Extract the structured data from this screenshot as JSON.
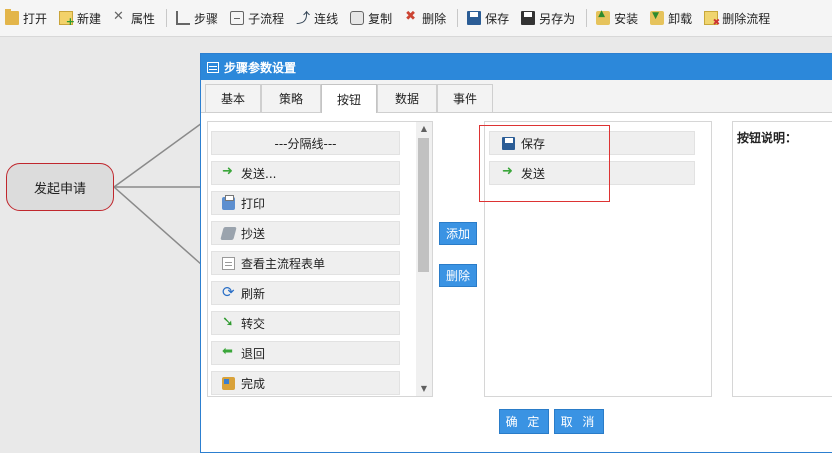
{
  "toolbar": {
    "items": [
      {
        "label": "打开",
        "icon": "folder-open-icon"
      },
      {
        "label": "新建",
        "icon": "new-icon"
      },
      {
        "label": "属性",
        "icon": "tools-icon"
      },
      {
        "label": "步骤",
        "icon": "step-icon"
      },
      {
        "label": "子流程",
        "icon": "subflow-icon"
      },
      {
        "label": "连线",
        "icon": "link-icon"
      },
      {
        "label": "复制",
        "icon": "copy-icon"
      },
      {
        "label": "删除",
        "icon": "delete-icon"
      },
      {
        "label": "保存",
        "icon": "save-icon"
      },
      {
        "label": "另存为",
        "icon": "save-as-icon"
      },
      {
        "label": "安装",
        "icon": "install-icon"
      },
      {
        "label": "卸载",
        "icon": "uninstall-icon"
      },
      {
        "label": "删除流程",
        "icon": "delete-flow-icon"
      }
    ]
  },
  "canvas": {
    "start_node_label": "发起申请"
  },
  "dialog": {
    "title": "步骤参数设置",
    "tabs": [
      "基本",
      "策略",
      "按钮",
      "数据",
      "事件"
    ],
    "active_tab": "按钮",
    "available_buttons": [
      {
        "label": "---分隔线---",
        "icon": ""
      },
      {
        "label": "发送...",
        "icon": "arrow-right-icon"
      },
      {
        "label": "打印",
        "icon": "printer-icon"
      },
      {
        "label": "抄送",
        "icon": "cc-icon"
      },
      {
        "label": "查看主流程表单",
        "icon": "document-icon"
      },
      {
        "label": "刷新",
        "icon": "refresh-icon"
      },
      {
        "label": "转交",
        "icon": "transfer-icon"
      },
      {
        "label": "退回",
        "icon": "back-icon"
      },
      {
        "label": "完成",
        "icon": "complete-icon"
      }
    ],
    "add_label": "添加",
    "remove_label": "删除",
    "selected_buttons": [
      {
        "label": "保存",
        "icon": "save-icon"
      },
      {
        "label": "发送",
        "icon": "arrow-right-icon"
      }
    ],
    "description_label": "按钮说明：",
    "ok_label": "确 定",
    "cancel_label": "取 消"
  },
  "colors": {
    "accent": "#2c88da",
    "node_border": "#c0272d",
    "highlight": "#dd3333"
  }
}
